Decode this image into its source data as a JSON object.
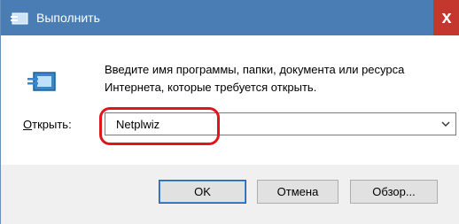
{
  "window": {
    "title": "Выполнить",
    "close_glyph": "x"
  },
  "main": {
    "description": "Введите имя программы, папки, документа или ресурса Интернета, которые требуется открыть.",
    "open_label_accel": "О",
    "open_label_rest": "ткрыть:",
    "input_value": "Netplwiz"
  },
  "buttons": {
    "ok": "OK",
    "cancel": "Отмена",
    "browse": "Обзор..."
  },
  "colors": {
    "titlebar": "#4a7db4",
    "close": "#c4372f",
    "highlight": "#e0161b"
  },
  "icons": [
    "run-app-icon",
    "run-dialog-icon",
    "chevron-down-icon"
  ]
}
